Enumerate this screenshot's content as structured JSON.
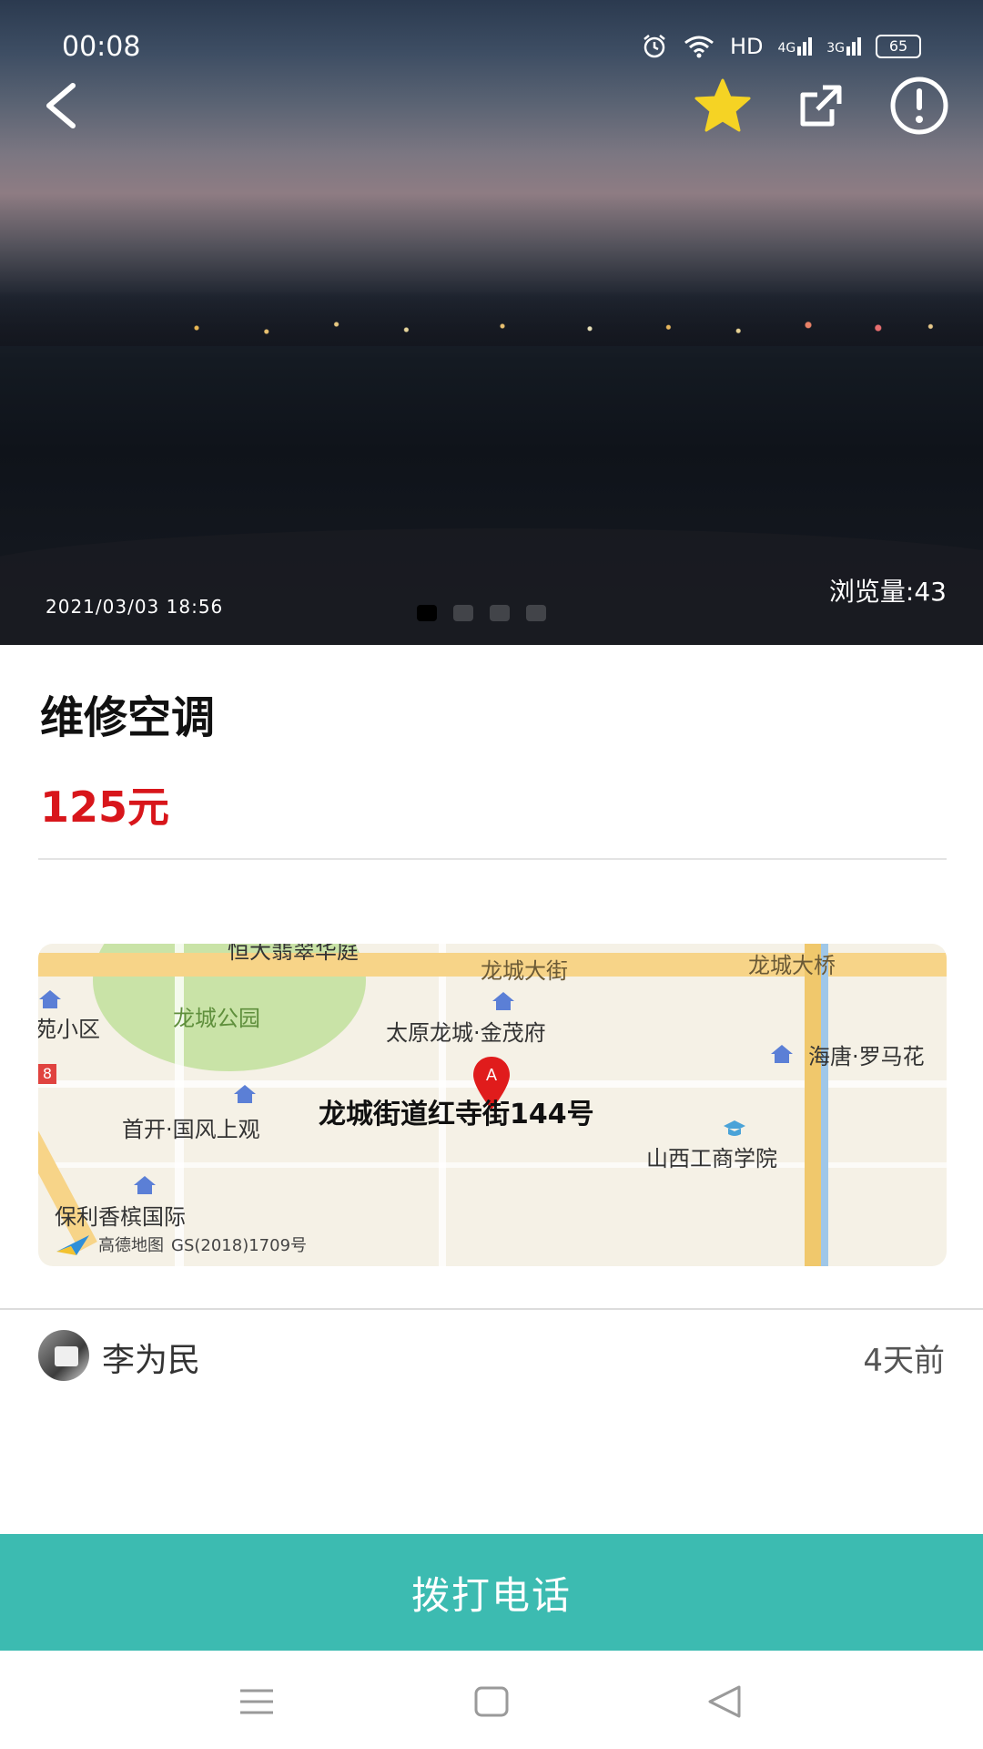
{
  "status_bar": {
    "time": "00:08",
    "network_label": "HD",
    "sig1": "4G",
    "sig2": "3G",
    "battery": "65"
  },
  "hero": {
    "date": "2021/03/03 18:56",
    "views": "浏览量:43",
    "slides_total": 4,
    "slide_active": 1
  },
  "actions": {
    "back_icon": "chevron-left-icon",
    "favorite_icon": "star-icon",
    "favorite_color": "#f5d324",
    "share_icon": "share-icon",
    "report_icon": "alert-circle-icon"
  },
  "listing": {
    "title": "维修空调",
    "price": "125元",
    "price_color": "#d8161b"
  },
  "map": {
    "labels": {
      "top_cut": "恒大翡翠华庭",
      "road_top": "龙城大街",
      "bridge": "龙城大桥",
      "park": "龙城公园",
      "jinmaofu": "太原龙城·金茂府",
      "haitang": "海唐·罗马花",
      "left_area": "苑小区",
      "guofeng": "首开·国风上观",
      "address": "龙城街道红寺街144号",
      "college": "山西工商学院",
      "poly": "保利香槟国际",
      "badge": "8",
      "attribution": "高德地图",
      "license": "GS(2018)1709号"
    },
    "marker_letter": "A"
  },
  "author": {
    "name": "李为民",
    "posted": "4天前"
  },
  "cta": {
    "label": "拨打电话",
    "color": "#3cbbb1"
  },
  "nav": {
    "menu_icon": "menu-icon",
    "home_icon": "home-square-icon",
    "back_icon": "back-triangle-icon"
  }
}
